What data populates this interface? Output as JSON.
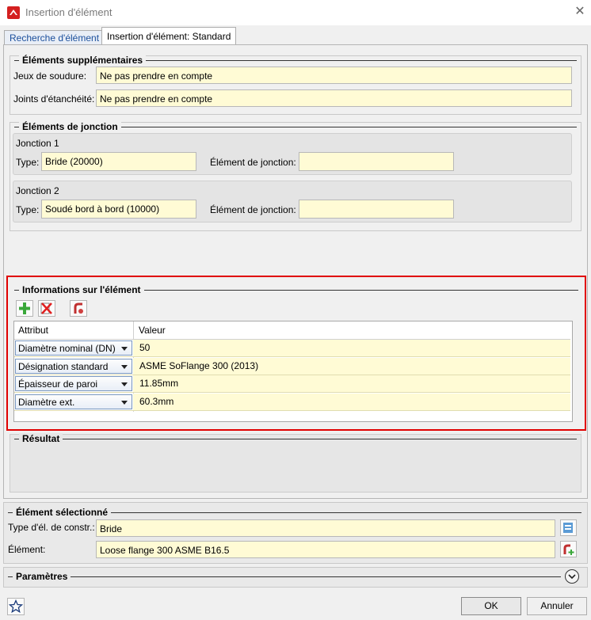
{
  "window": {
    "title": "Insertion d'élément",
    "close": "✕"
  },
  "tabs": [
    {
      "label": "Recherche d'élément"
    },
    {
      "label": "Insertion d'élément: Standard"
    }
  ],
  "supplementary": {
    "title": "Éléments supplémentaires",
    "welding_label": "Jeux de soudure:",
    "welding_value": "Ne pas prendre en compte",
    "seal_label": "Joints d'étanchéité:",
    "seal_value": "Ne pas prendre en compte"
  },
  "junctions": {
    "title": "Éléments de jonction",
    "j1": {
      "title": "Jonction 1",
      "type_label": "Type:",
      "type_value": "Bride (20000)",
      "elem_label": "Élément de jonction:",
      "elem_value": ""
    },
    "j2": {
      "title": "Jonction 2",
      "type_label": "Type:",
      "type_value": "Soudé bord à bord (10000)",
      "elem_label": "Élément de jonction:",
      "elem_value": ""
    }
  },
  "info": {
    "title": "Informations sur l'élément",
    "col_attr": "Attribut",
    "col_val": "Valeur",
    "rows": [
      {
        "attr": "Diamètre nominal (DN)",
        "value": "50"
      },
      {
        "attr": "Désignation standard",
        "value": "ASME SoFlange 300 (2013)"
      },
      {
        "attr": "Épaisseur de paroi",
        "value": "11.85mm"
      },
      {
        "attr": "Diamètre ext.",
        "value": "60.3mm"
      }
    ]
  },
  "result": {
    "title": "Résultat"
  },
  "selected": {
    "title": "Élément sélectionné",
    "type_label": "Type d'él. de constr.:",
    "type_value": "Bride",
    "elem_label": "Élément:",
    "elem_value": "Loose flange 300 ASME B16.5"
  },
  "params": {
    "title": "Paramètres"
  },
  "footer": {
    "ok": "OK",
    "cancel": "Annuler"
  },
  "colors": {
    "field_bg": "#fffbd5",
    "highlight_border": "#e00000",
    "tab_active_text": "#1b4f9c"
  }
}
